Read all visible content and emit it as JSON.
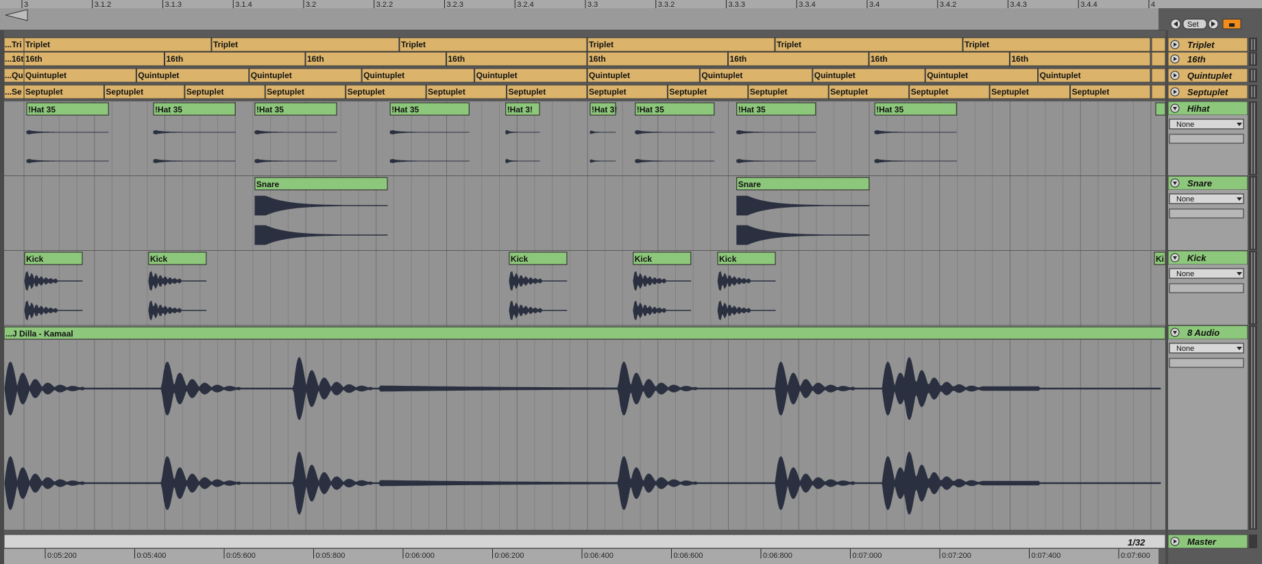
{
  "ruler": {
    "bars": [
      "3",
      "3.1.2",
      "3.1.3",
      "3.1.4",
      "3.2",
      "3.2.2",
      "3.2.3",
      "3.2.4",
      "3.3",
      "3.3.2",
      "3.3.3",
      "3.3.4",
      "3.4",
      "3.4.2",
      "3.4.3",
      "3.4.4",
      "4"
    ]
  },
  "locators": {
    "set_label": "Set"
  },
  "tracks": [
    {
      "name": "Triplet",
      "label_prefix": "...Tri",
      "clip_label": "Triplet"
    },
    {
      "name": "16th",
      "label_prefix": "...16t",
      "clip_label": "16th"
    },
    {
      "name": "Quintuplet",
      "label_prefix": "...Qu",
      "clip_label": "Quintuplet"
    },
    {
      "name": "Septuplet",
      "label_prefix": "...Se",
      "clip_label": "Septuplet"
    },
    {
      "name": "Hihat",
      "clip_label": "!Hat 35",
      "short_label": "!Hat 3!",
      "input": "None"
    },
    {
      "name": "Snare",
      "clip_label": "Snare",
      "input": "None"
    },
    {
      "name": "Kick",
      "clip_label": "Kick",
      "edge_label": "Ki",
      "input": "None"
    },
    {
      "name": "8 Audio",
      "clip_label": "...J Dilla - Kamaal",
      "input": "None"
    }
  ],
  "master": {
    "name": "Master",
    "zoom": "1/32"
  },
  "time_ruler": [
    "0:05:200",
    "0:05:400",
    "0:05:600",
    "0:05:800",
    "0:06:000",
    "0:06:200",
    "0:06:400",
    "0:06:600",
    "0:06:800",
    "0:07:000",
    "0:07:200",
    "0:07:400",
    "0:07:600"
  ],
  "colors": {
    "meter_clip": "#dbb36a",
    "audio_clip": "#8dc77b",
    "track_bg": "#939393",
    "accent": "#f28c1a"
  }
}
